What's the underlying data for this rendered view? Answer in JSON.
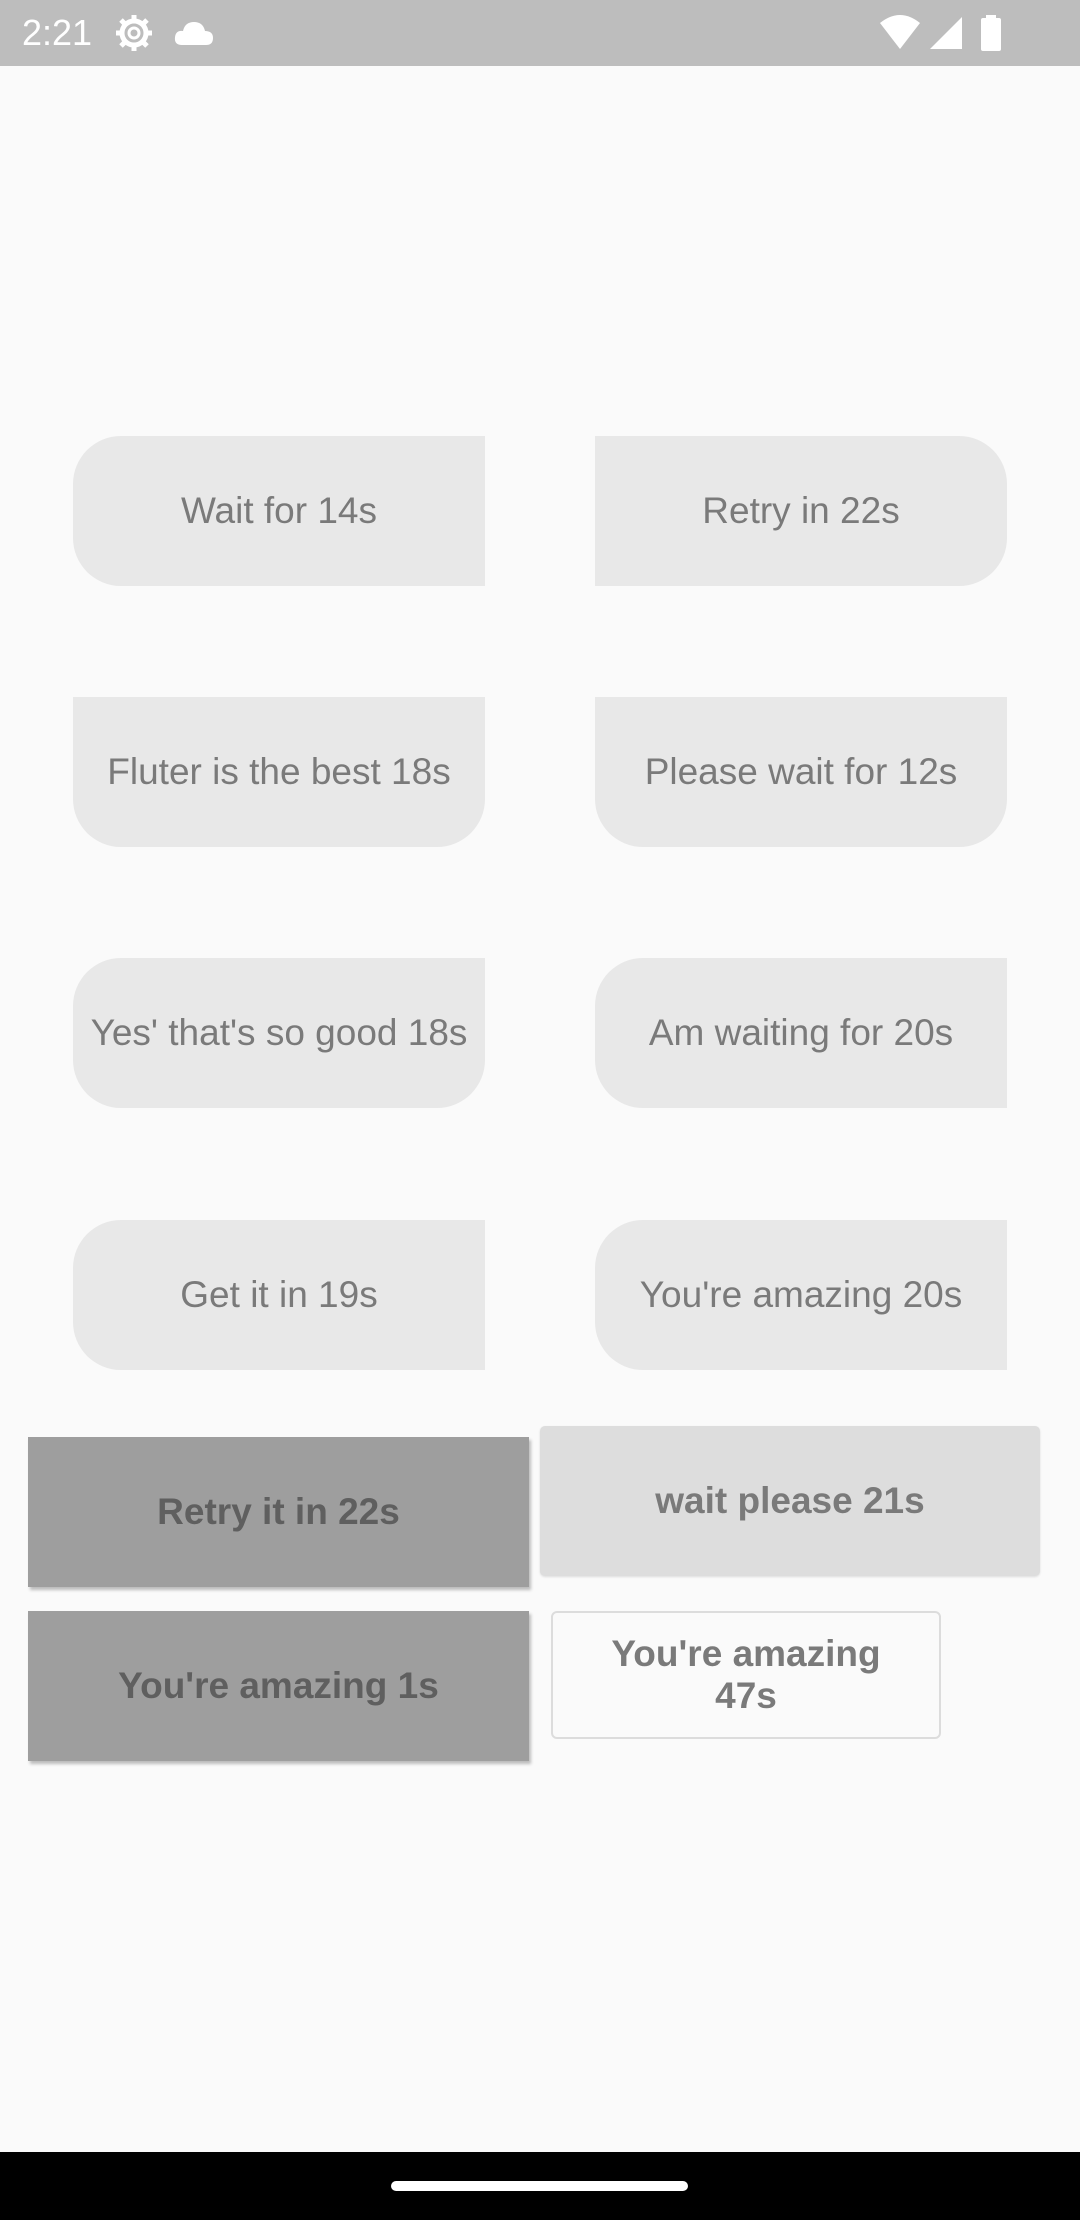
{
  "status_bar": {
    "time": "2:21",
    "icons": [
      "gear-icon",
      "cloud-icon",
      "wifi-icon",
      "signal-icon",
      "battery-icon"
    ]
  },
  "countdown_buttons": [
    {
      "label": "Wait for 14s"
    },
    {
      "label": "Retry in 22s"
    },
    {
      "label": "Fluter is the best 18s"
    },
    {
      "label": "Please wait for 12s"
    },
    {
      "label": "Yes' that's so good 18s"
    },
    {
      "label": "Am waiting for 20s"
    },
    {
      "label": "Get it in 19s"
    },
    {
      "label": "You're amazing 20s"
    }
  ],
  "action_buttons": {
    "retry": "Retry it in 22s",
    "wait_please": "wait please 21s",
    "amazing_1": "You're amazing 1s",
    "amazing_47": "You're amazing 47s"
  },
  "colors": {
    "background": "#fafafa",
    "status_bar": "#bdbdbd",
    "button_fill": "#e8e8e8",
    "raised_fill": "#9e9e9e",
    "flat_fill": "#dddddd",
    "text": "#7a7a7a"
  }
}
